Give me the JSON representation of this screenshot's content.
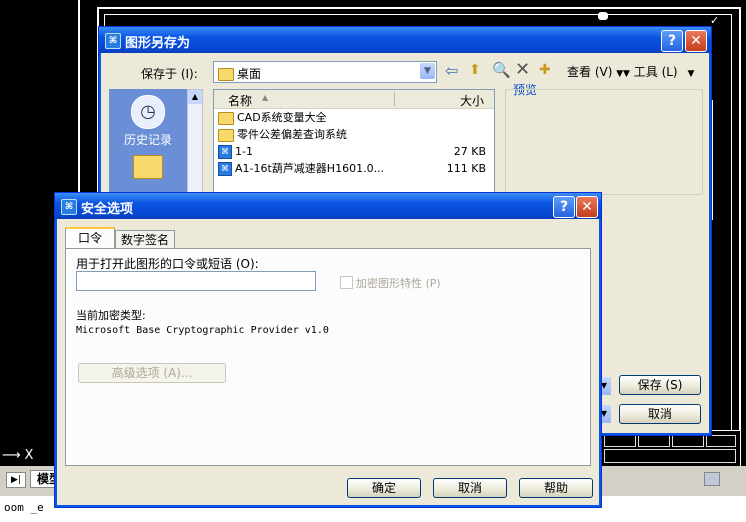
{
  "background": {
    "ucs_label": "X",
    "model_tab": "模型",
    "command_text": "oom _e"
  },
  "save_dialog": {
    "title": "图形另存为",
    "save_in_label": "保存于 (I):",
    "location": "桌面",
    "view_menu": "查看 (V)",
    "tools_menu": "工具 (L)",
    "places": {
      "history": "历史记录"
    },
    "columns": {
      "name": "名称",
      "size": "大小"
    },
    "files": [
      {
        "name": "CAD系统变量大全",
        "size": "",
        "type": "folder"
      },
      {
        "name": "零件公差偏差查询系统",
        "size": "",
        "type": "folder"
      },
      {
        "name": "1-1",
        "size": "27 KB",
        "type": "dwg"
      },
      {
        "name": "A1-16t葫芦减速器H1601.0...",
        "size": "111 KB",
        "type": "dwg"
      }
    ],
    "preview_label": "预览",
    "save_button": "保存 (S)",
    "cancel_button": "取消"
  },
  "security_dialog": {
    "title": "安全选项",
    "tabs": [
      "口令",
      "数字签名"
    ],
    "password_label": "用于打开此图形的口令或短语 (O):",
    "password_value": "",
    "encrypt_props_label": "加密图形特性 (P)",
    "current_encryption_label": "当前加密类型:",
    "current_encryption_value": "Microsoft Base Cryptographic Provider v1.0",
    "advanced_button": "高级选项 (A)...",
    "ok_button": "确定",
    "cancel_button": "取消",
    "help_button": "帮助"
  },
  "colors": {
    "titlebar": "#0a54e3",
    "dialog_face": "#ece9d8",
    "places_bar": "#6b8fd6"
  }
}
